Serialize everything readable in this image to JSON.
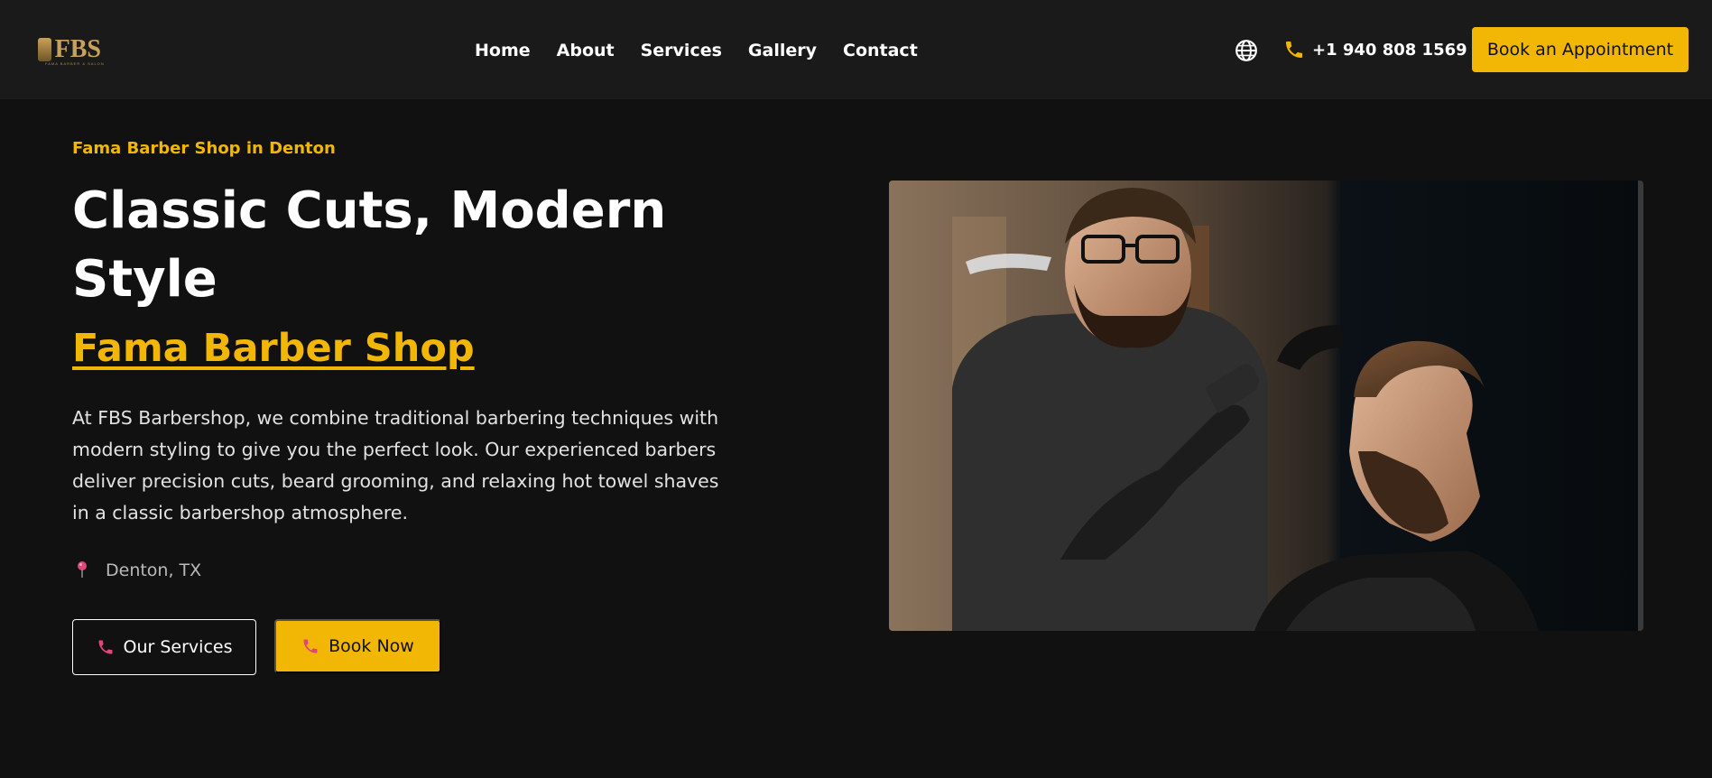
{
  "header": {
    "logo_text": "FBS",
    "logo_tagline": "FAMA BARBER & SALON",
    "nav": [
      "Home",
      "About",
      "Services",
      "Gallery",
      "Contact"
    ],
    "phone": "+1 940 808 1569",
    "cta": "Book an Appointment"
  },
  "hero": {
    "eyebrow": "Fama Barber Shop in Denton",
    "title": "Classic Cuts, Modern Style",
    "subtitle": "Fama Barber Shop",
    "description": "At FBS Barbershop, we combine traditional barbering techniques with modern styling to give you the perfect look. Our experienced barbers deliver precision cuts, beard grooming, and relaxing hot towel shaves in a classic barbershop atmosphere.",
    "location": "Denton, TX",
    "buttons": {
      "services": "Our Services",
      "book": "Book Now"
    }
  },
  "icons": {
    "globe": "globe-icon",
    "phone": "phone-icon",
    "location": "map-pin-icon"
  },
  "colors": {
    "accent": "#f2b705",
    "background": "#111111",
    "header": "#1a1a1a",
    "pin": "#e0457b"
  }
}
